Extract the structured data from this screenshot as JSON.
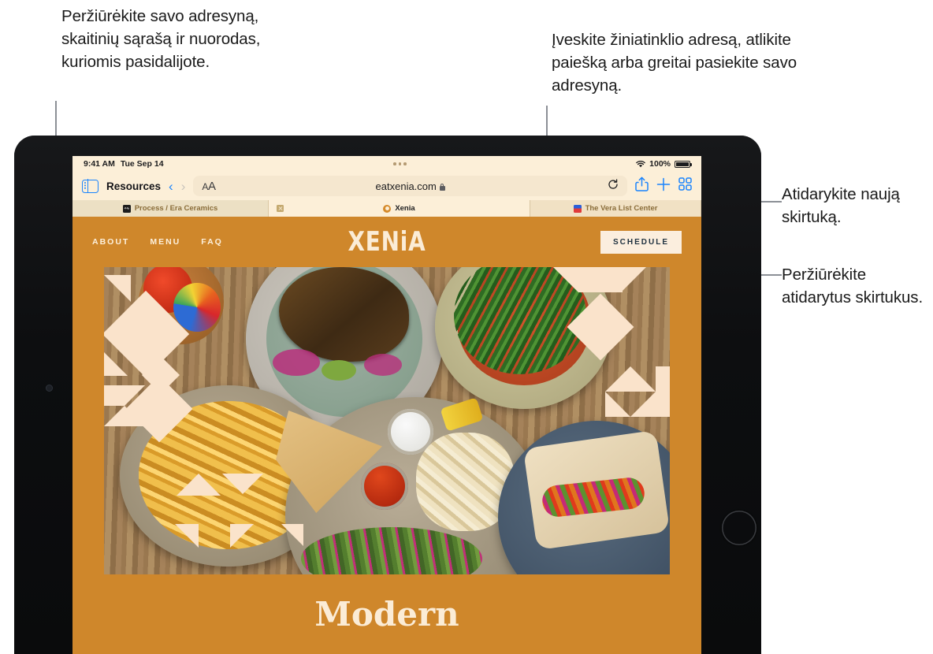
{
  "callouts": {
    "bookmarks": "Peržiūrėkite savo adresyną, skaitinių sąrašą ir nuorodas, kuriomis pasidalijote.",
    "address": "Įveskite žiniatinklio adresą, atlikite paiešką arba greitai pasiekite savo adresyną.",
    "new_tab": "Atidarykite naują skirtuką.",
    "view_tabs": "Peržiūrėkite atidarytus skirtukus."
  },
  "status_bar": {
    "time": "9:41 AM",
    "date": "Tue Sep 14",
    "multitask_icon": "ellipsis-icon",
    "wifi_icon": "wifi-icon",
    "battery_percent": "100%",
    "battery_icon": "battery-icon"
  },
  "toolbar": {
    "sidebar_icon": "sidebar-icon",
    "sidebar_label": "Resources",
    "back_icon": "chevron-left-icon",
    "forward_icon": "chevron-right-icon",
    "text_size_label": "AA",
    "url": "eatxenia.com",
    "lock_icon": "lock-icon",
    "reload_icon": "reload-icon",
    "share_icon": "share-icon",
    "new_tab_icon": "plus-icon",
    "tab_overview_icon": "grid-icon"
  },
  "tabs": [
    {
      "title": "Process / Era Ceramics",
      "favicon": "process-era-ceramics-favicon",
      "active": false
    },
    {
      "title": "Xenia",
      "favicon": "xenia-favicon",
      "active": true
    },
    {
      "title": "The Vera List Center",
      "favicon": "vera-list-center-favicon",
      "active": false
    }
  ],
  "site": {
    "nav_links": [
      "ABOUT",
      "MENU",
      "FAQ"
    ],
    "brand": "XENiA",
    "cta_label": "SCHEDULE",
    "tagline": "Modern",
    "hero_alt": "overhead-photo-of-mediterranean-dishes"
  },
  "colors": {
    "site_orange": "#cf872b",
    "cream": "#fbecd6",
    "toolbar_bg": "#fcefd8",
    "tabbar_bg": "#f1e1c4",
    "accent_blue": "#1a84fd",
    "callout_line": "#8c9096"
  }
}
